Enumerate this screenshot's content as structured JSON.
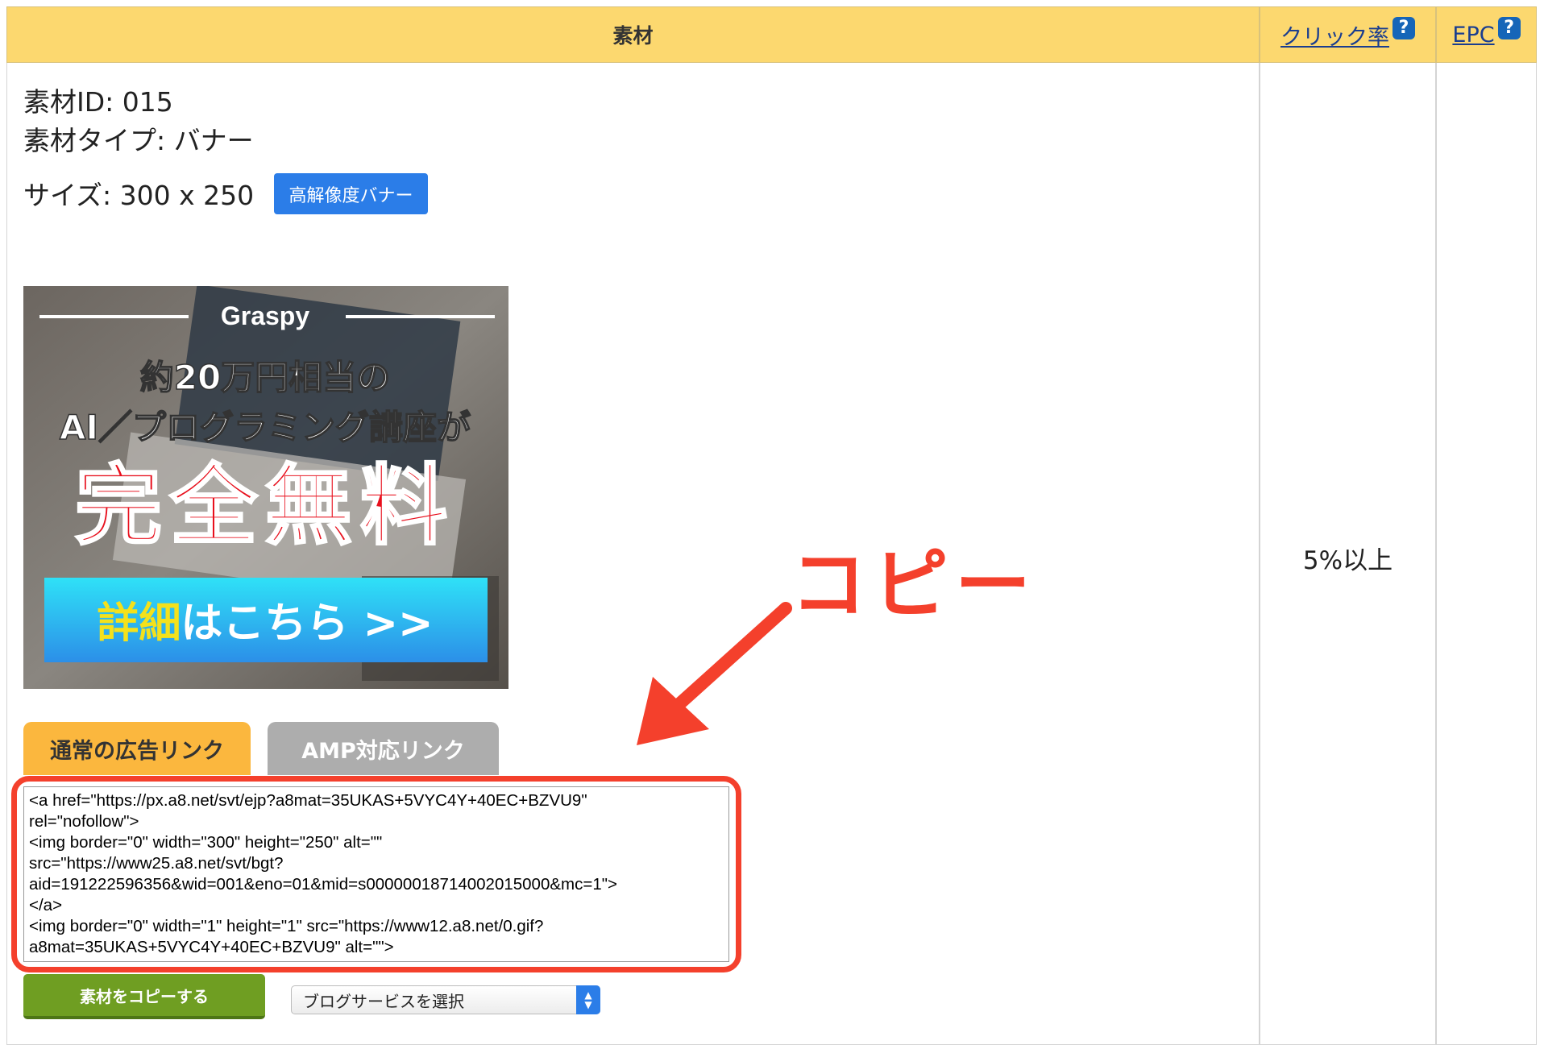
{
  "header": {
    "material": "素材",
    "click_rate": "クリック率",
    "epc": "EPC",
    "help_glyph": "?"
  },
  "material": {
    "id_line": "素材ID: 015",
    "type_line": "素材タイプ: バナー",
    "size_line": "サイズ: 300 x 250",
    "hires_button": "高解像度バナー"
  },
  "banner": {
    "brand": "Graspy",
    "line1": "約20万円相当の",
    "line2": "AI／プログラミング講座が",
    "headline": "完全無料",
    "cta_yellow": "詳細",
    "cta_white": "はこちら >>"
  },
  "tabs": {
    "normal": "通常の広告リンク",
    "amp": "AMP対応リンク"
  },
  "code": "<a href=\"https://px.a8.net/svt/ejp?a8mat=35UKAS+5VYC4Y+40EC+BZVU9\"\nrel=\"nofollow\">\n<img border=\"0\" width=\"300\" height=\"250\" alt=\"\"\nsrc=\"https://www25.a8.net/svt/bgt?\naid=191222596356&wid=001&eno=01&mid=s00000018714002015000&mc=1\">\n</a>\n<img border=\"0\" width=\"1\" height=\"1\" src=\"https://www12.a8.net/0.gif?\na8mat=35UKAS+5VYC4Y+40EC+BZVU9\" alt=\"\">",
  "actions": {
    "copy_button": "素材をコピーする",
    "blog_select": "ブログサービスを選択"
  },
  "stats": {
    "click_rate": "5%以上"
  },
  "annotation": {
    "label": "コピー",
    "color": "#f4402c"
  }
}
